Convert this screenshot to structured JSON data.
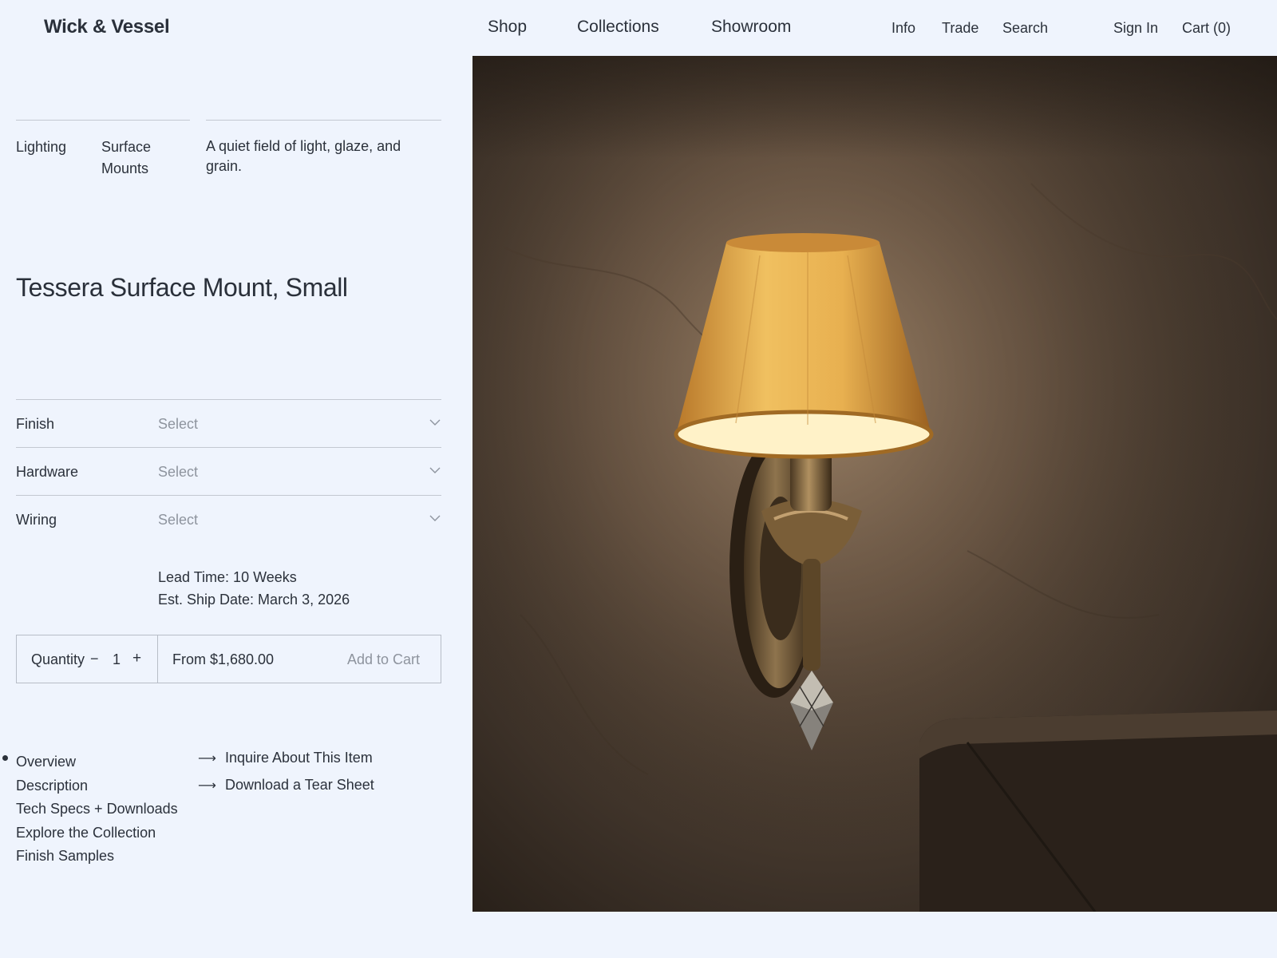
{
  "header": {
    "logo": "Wick & Vessel",
    "main_nav": [
      "Shop",
      "Collections",
      "Showroom"
    ],
    "utility_nav": [
      "Info",
      "Trade",
      "Search",
      "Sign In",
      "Cart (0)"
    ]
  },
  "breadcrumb": {
    "category": "Lighting",
    "subcategory_line1": "Surface",
    "subcategory_line2": "Mounts",
    "tagline_line1": "A quiet field of light, glaze, and",
    "tagline_line2": "grain."
  },
  "product": {
    "title": "Tessera Surface Mount, Small"
  },
  "options": [
    {
      "label": "Finish",
      "value": "Select"
    },
    {
      "label": "Hardware",
      "value": "Select"
    },
    {
      "label": "Wiring",
      "value": "Select"
    }
  ],
  "shipping": {
    "lead_time": "Lead Time: 10 Weeks",
    "ship_date": "Est. Ship Date: March 3, 2026"
  },
  "cart": {
    "quantity_label": "Quantity",
    "minus": "−",
    "quantity_value": "1",
    "plus": "+",
    "price": "From $1,680.00",
    "add_to_cart": "Add to Cart"
  },
  "section_nav": [
    "Overview",
    "Description",
    "Tech Specs + Downloads",
    "Explore the Collection",
    "Finish Samples"
  ],
  "links": [
    {
      "arrow": "⟶",
      "label": "Inquire About This Item"
    },
    {
      "arrow": "⟶",
      "label": "Download a Tear Sheet"
    }
  ],
  "colors": {
    "background": "#eff4fd",
    "text": "#2b313b",
    "muted": "#8e949e",
    "rule": "#c3c8d1"
  }
}
